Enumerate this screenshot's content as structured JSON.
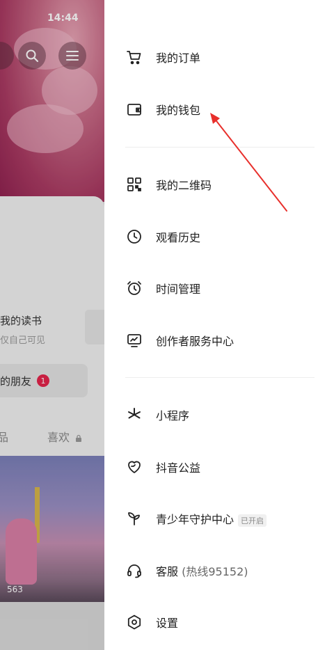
{
  "status_bar": {
    "time": "14:44"
  },
  "background": {
    "reading_title": "我的读书",
    "reading_subtitle": "仅自己可见",
    "friends_button": "的朋友",
    "friends_badge": "1",
    "tab_left": "品",
    "tab_likes": "喜欢",
    "thumb_count": "563"
  },
  "drawer": {
    "items": [
      {
        "label": "我的订单",
        "icon": "cart-icon"
      },
      {
        "label": "我的钱包",
        "icon": "wallet-icon"
      },
      {
        "label": "我的二维码",
        "icon": "qr-code-icon"
      },
      {
        "label": "观看历史",
        "icon": "clock-icon"
      },
      {
        "label": "时间管理",
        "icon": "alarm-clock-icon"
      },
      {
        "label": "创作者服务中心",
        "icon": "creator-monitor-icon"
      },
      {
        "label": "小程序",
        "icon": "mini-program-icon"
      },
      {
        "label": "抖音公益",
        "icon": "charity-heart-icon"
      },
      {
        "label": "青少年守护中心",
        "icon": "sprout-icon",
        "tag": "已开启"
      },
      {
        "label": "客服",
        "note": "(热线95152)",
        "icon": "headset-icon"
      },
      {
        "label": "设置",
        "icon": "settings-icon"
      }
    ]
  },
  "colors": {
    "badge": "#e4244b",
    "annotation_arrow": "#e8302c"
  }
}
